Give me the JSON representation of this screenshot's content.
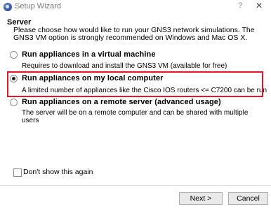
{
  "window": {
    "title": "Setup Wizard",
    "help_label": "?",
    "close_label": "✕"
  },
  "section": {
    "title": "Server",
    "description": "Please choose how would like to run your GNS3 network simulations. The GNS3 VM option is strongly recommended on Windows and Mac OS X."
  },
  "options": [
    {
      "label": "Run appliances in a virtual machine",
      "description": "Requires to download and install the GNS3 VM (available for free)",
      "selected": false
    },
    {
      "label": "Run appliances on my local computer",
      "description": "A limited number of appliances like the Cisco IOS routers <= C7200 can be run",
      "selected": true
    },
    {
      "label": "Run appliances on a remote server (advanced usage)",
      "description": "The server will be on a remote computer and can be shared with multiple users",
      "selected": false
    }
  ],
  "dont_show": {
    "label": "Don't show this again",
    "checked": false
  },
  "buttons": {
    "next": "Next >",
    "cancel": "Cancel"
  },
  "colors": {
    "highlight": "#e8142a"
  }
}
